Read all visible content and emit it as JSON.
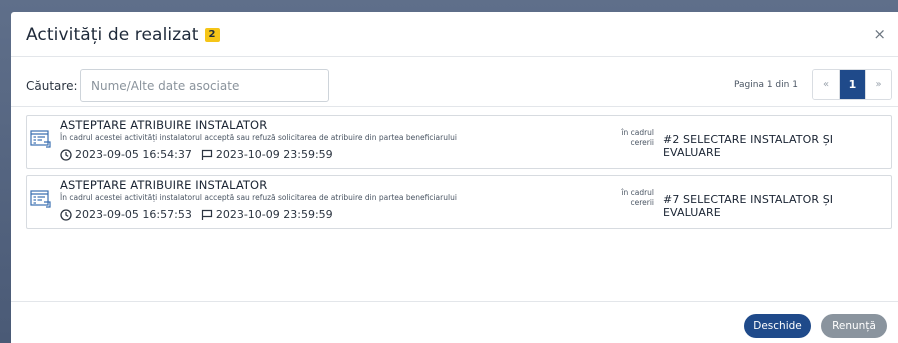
{
  "dialog": {
    "title": "Activități de realizat",
    "badge_count": "2",
    "close_symbol": "×"
  },
  "search": {
    "label": "Căutare:",
    "placeholder": "Nume/Alte date asociate",
    "value": ""
  },
  "pagination": {
    "text": "Pagina 1 din 1",
    "prev": "«",
    "current": "1",
    "next": "»"
  },
  "tasks": [
    {
      "title": "ASTEPTARE ATRIBUIRE INSTALATOR",
      "description": "În cadrul acestei activități instalatorul acceptă sau refuză solicitarea de atribuire din partea beneficiarului",
      "start": "2023-09-05 16:54:37",
      "deadline": "2023-10-09 23:59:59",
      "context_line1": "în cadrul",
      "context_line2": "cererii",
      "request": "#2 SELECTARE INSTALATOR ȘI EVALUARE",
      "icon": "task-list-icon"
    },
    {
      "title": "ASTEPTARE ATRIBUIRE INSTALATOR",
      "description": "În cadrul acestei activități instalatorul acceptă sau refuză solicitarea de atribuire din partea beneficiarului",
      "start": "2023-09-05 16:57:53",
      "deadline": "2023-10-09 23:59:59",
      "context_line1": "în cadrul",
      "context_line2": "cererii",
      "request": "#7 SELECTARE INSTALATOR ȘI EVALUARE",
      "icon": "task-list-icon"
    }
  ],
  "footer": {
    "open_label": "Deschide",
    "cancel_label": "Renunță"
  },
  "colors": {
    "primary": "#1f4a8a",
    "secondary": "#8a949e",
    "badge": "#f5c518",
    "icon_blue": "#3a6fb0"
  }
}
